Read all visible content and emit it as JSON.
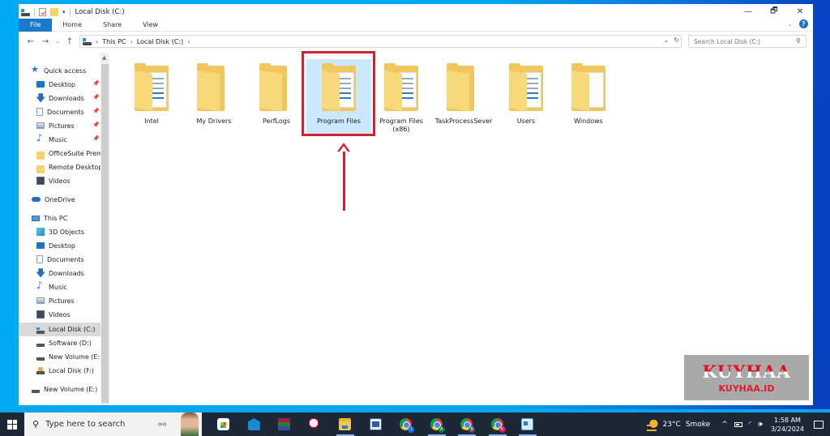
{
  "window": {
    "title": "Local Disk (C:)",
    "qat_dropdown": "▾",
    "controls": {
      "minimize": "—",
      "maximize": "🗗",
      "close": "✕"
    }
  },
  "ribbon": {
    "tabs": [
      {
        "label": "File"
      },
      {
        "label": "Home"
      },
      {
        "label": "Share"
      },
      {
        "label": "View"
      }
    ],
    "expand": "⌄",
    "help": "?"
  },
  "navigation": {
    "back": "←",
    "forward": "→",
    "recent": "⌄",
    "up": "↑",
    "breadcrumb": [
      "This PC",
      "Local Disk (C:)"
    ],
    "separator": "›",
    "dropdown": "⌄",
    "refresh": "↻",
    "search_placeholder": "Search Local Disk (C:)",
    "search_glyph": "⚲"
  },
  "sidebar": {
    "quick_access": {
      "label": "Quick access",
      "items": [
        {
          "label": "Desktop",
          "icon": "desktop-icon",
          "pinned": true
        },
        {
          "label": "Downloads",
          "icon": "downloads-icon",
          "pinned": true
        },
        {
          "label": "Documents",
          "icon": "documents-icon",
          "pinned": true
        },
        {
          "label": "Pictures",
          "icon": "pictures-icon",
          "pinned": true
        },
        {
          "label": "Music",
          "icon": "music-icon",
          "pinned": true
        },
        {
          "label": "OfficeSuite Prem",
          "icon": "folder-icon",
          "pinned": false
        },
        {
          "label": "Remote Desktop",
          "icon": "folder-icon",
          "pinned": false
        },
        {
          "label": "Videos",
          "icon": "videos-icon",
          "pinned": false
        }
      ]
    },
    "onedrive": {
      "label": "OneDrive"
    },
    "this_pc": {
      "label": "This PC",
      "items": [
        {
          "label": "3D Objects"
        },
        {
          "label": "Desktop"
        },
        {
          "label": "Documents"
        },
        {
          "label": "Downloads"
        },
        {
          "label": "Music"
        },
        {
          "label": "Pictures"
        },
        {
          "label": "Videos"
        },
        {
          "label": "Local Disk (C:)",
          "selected": true
        },
        {
          "label": "Software (D:)"
        },
        {
          "label": "New Volume (E:)"
        },
        {
          "label": "Local Disk (F:)"
        }
      ]
    },
    "network_drive": {
      "label": "New Volume (E:)"
    },
    "pin_glyph": "📌"
  },
  "content": {
    "folders": [
      {
        "name": "Intel",
        "selected": false
      },
      {
        "name": "My Drivers",
        "selected": false
      },
      {
        "name": "PerfLogs",
        "selected": false
      },
      {
        "name": "Program Files",
        "selected": true
      },
      {
        "name": "Program Files (x86)",
        "selected": false
      },
      {
        "name": "TaskProcessSever",
        "selected": false
      },
      {
        "name": "Users",
        "selected": false
      },
      {
        "name": "Windows",
        "selected": false
      }
    ]
  },
  "annotation": {
    "highlight_target": "Program Files",
    "color": "#d0232e"
  },
  "watermark": {
    "title": "KUYHAA",
    "subtitle": "KUYHAA.ID"
  },
  "taskbar": {
    "search_placeholder": "Type here to search",
    "apps": [
      {
        "name": "Microsoft Store"
      },
      {
        "name": "Mail"
      },
      {
        "name": "WinRAR"
      },
      {
        "name": "Snipping Tool"
      },
      {
        "name": "File Explorer",
        "active": true
      },
      {
        "name": "Word"
      },
      {
        "name": "Chrome profile I",
        "badge": "I"
      },
      {
        "name": "Chrome profile A",
        "badge": "A",
        "active": true
      },
      {
        "name": "Chrome profile B",
        "badge": "B",
        "active": true
      },
      {
        "name": "Chrome profile K",
        "badge": "K",
        "active": true
      },
      {
        "name": "Remote Desktop",
        "active": true
      }
    ],
    "weather": {
      "temp": "23°C",
      "condition": "Smoke"
    },
    "tray": {
      "chevron": "^",
      "wifi": "◜",
      "volume": "🕪"
    },
    "clock": {
      "time": "1:58 AM",
      "date": "3/24/2024"
    }
  },
  "colors": {
    "accent": "#1979ca",
    "selection": "#cce8ff",
    "folder": "#f0c75e",
    "taskbar": "#1c2838"
  }
}
